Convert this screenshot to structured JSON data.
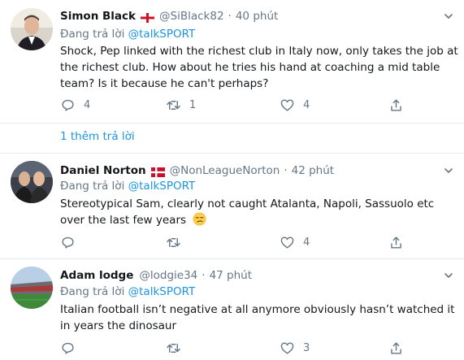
{
  "tweets": [
    {
      "name": "Simon Black",
      "handle": "@SiBlack82",
      "time": "40 phút",
      "reply_prefix": "Đang trả lời",
      "reply_to": "@talkSPORT",
      "text": "Shock, Pep linked with the richest club in Italy now, only takes the job at the richest club. How about he tries his hand at coaching a mid table team? Is it because he can't perhaps?",
      "replies": "4",
      "retweets": "1",
      "likes": "4",
      "flag": "england-flag-icon"
    },
    {
      "name": "Daniel Norton",
      "handle": "@NonLeagueNorton",
      "time": "42 phút",
      "reply_prefix": "Đang trả lời",
      "reply_to": "@talkSPORT",
      "text": "Stereotypical Sam, clearly not caught Atalanta, Napoli, Sassuolo etc over the last few years",
      "replies": "",
      "retweets": "",
      "likes": "4",
      "flag": "denmark-flag-icon"
    },
    {
      "name": "Adam lodge",
      "handle": "@lodgie34",
      "time": "47 phút",
      "reply_prefix": "Đang trả lời",
      "reply_to": "@talkSPORT",
      "text": "Italian football isn’t negative at all anymore obviously hasn’t watched it in years the dinosaur",
      "replies": "",
      "retweets": "",
      "likes": "3"
    }
  ],
  "show_more": "1 thêm trả lời",
  "colors": {
    "accent": "#1b95e0",
    "muted": "#657786",
    "text": "#14171a",
    "border": "#e6ecf0"
  }
}
